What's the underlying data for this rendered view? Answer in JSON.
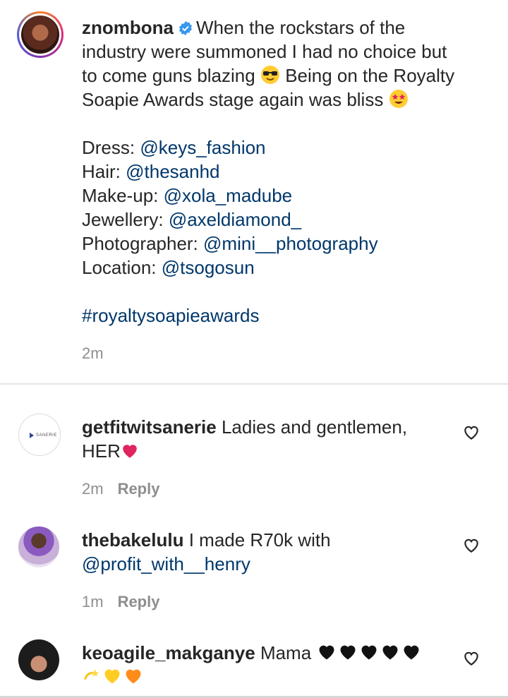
{
  "post": {
    "username": "znombona",
    "caption_line1": "When the rockstars of the",
    "caption_line2": "industry were summoned I had no choice but",
    "caption_line3a": "to come guns blazing",
    "caption_line3b": "Being on the Royalty",
    "caption_line4": "Soapie Awards stage again was bliss",
    "credits": [
      {
        "label": "Dress:",
        "handle": "@keys_fashion"
      },
      {
        "label": "Hair:",
        "handle": "@thesanhd"
      },
      {
        "label": "Make-up:",
        "handle": "@xola_madube"
      },
      {
        "label": "Jewellery:",
        "handle": "@axeldiamond_"
      },
      {
        "label": "Photographer:",
        "handle": "@mini__photography"
      },
      {
        "label": "Location:",
        "handle": "@tsogosun"
      }
    ],
    "hashtag": "#royaltysoapieawards",
    "time": "2m"
  },
  "comments": [
    {
      "username": "getfitwitsanerie",
      "text_line1": "Ladies and gentlemen,",
      "text_line2": "HER",
      "time": "2m",
      "reply_label": "Reply",
      "avatar_text": "SANERIE"
    },
    {
      "username": "thebakelulu",
      "text_line1": "I made R70k with",
      "mention": "@profit_with__henry",
      "time": "1m",
      "reply_label": "Reply"
    },
    {
      "username": "keoagile_makganye",
      "text_line1": "Mama"
    }
  ],
  "colors": {
    "link": "#00376b",
    "muted": "#8e8e8e",
    "verified": "#3897f0",
    "divider": "#e4e4e4"
  }
}
